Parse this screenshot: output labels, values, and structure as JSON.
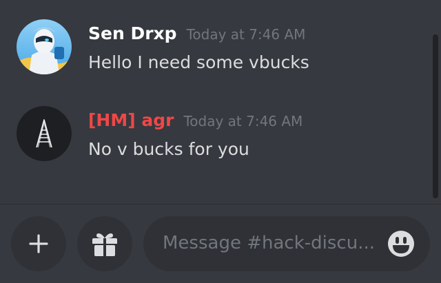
{
  "messages": [
    {
      "author": "Sen Drxp",
      "author_color": "#ffffff",
      "timestamp": "Today at 7:46 AM",
      "content": "Hello I need some vbucks",
      "avatar": "fortnite-character-avatar"
    },
    {
      "author": "[HM] agr",
      "author_color": "#f04747",
      "timestamp": "Today at 7:46 AM",
      "content": "No v bucks for you",
      "avatar": "letter-a-avatar"
    }
  ],
  "composer": {
    "placeholder": "Message #hack-discu...",
    "add_icon": "plus-icon",
    "gift_icon": "gift-icon",
    "emoji_icon": "emoji-smile-icon"
  },
  "colors": {
    "background": "#36393f",
    "button_background": "#2f3136",
    "text": "#dcddde",
    "muted": "#72767d",
    "role_red": "#f04747"
  }
}
